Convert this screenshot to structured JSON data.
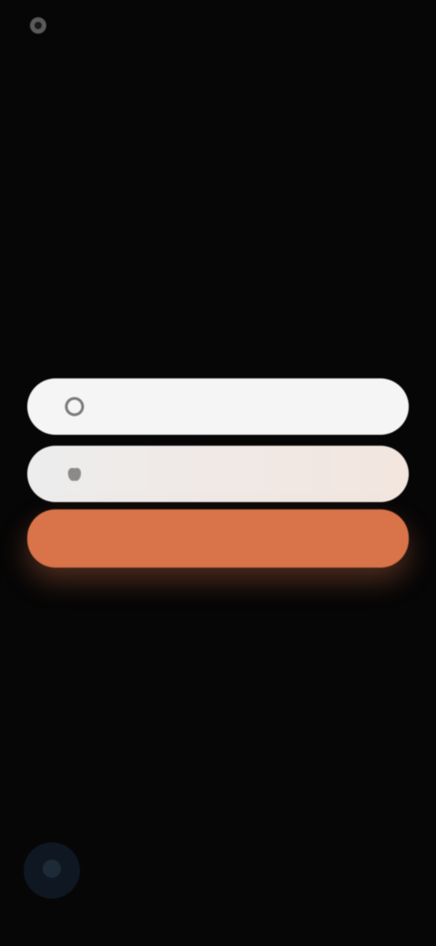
{
  "header": {
    "brand_name": "",
    "brand_icon": "app-logo-icon",
    "action_label": ""
  },
  "hero": {
    "title": "",
    "subtitle": ""
  },
  "auth": {
    "google_label": "",
    "google_icon": "google-icon",
    "apple_label": "",
    "apple_icon": "apple-icon",
    "email_label": "",
    "accent_color": "#d8734a"
  },
  "signup": {
    "prompt": "",
    "link_label": ""
  },
  "footer": {
    "help_icon": "help-chat-icon",
    "note": ""
  }
}
